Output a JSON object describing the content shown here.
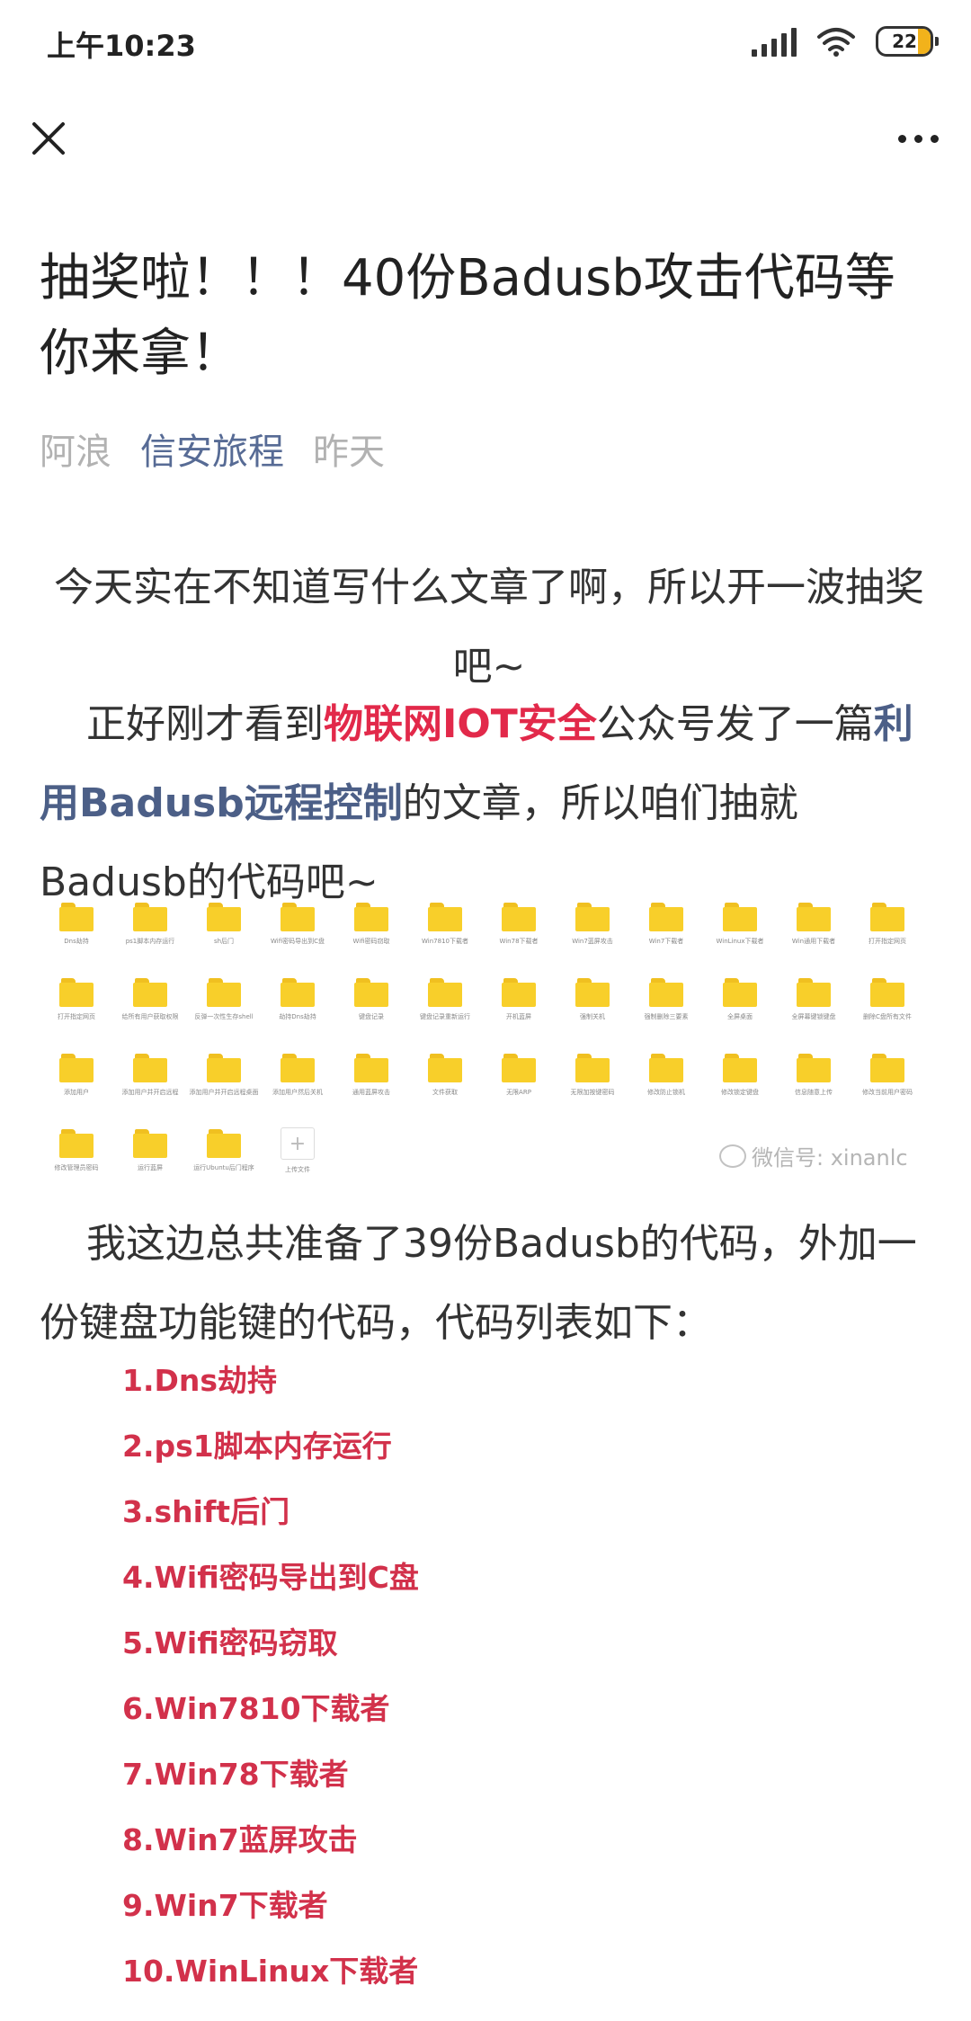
{
  "status": {
    "time": "上午10:23",
    "battery": "22",
    "battery_level": 0.22
  },
  "nav": {
    "close_icon": "close-icon",
    "more_icon": "more-icon"
  },
  "article": {
    "title": "抽奖啦！！！40份Badusb攻击代码等你来拿！",
    "author": "阿浪",
    "account": "信安旅程",
    "time": "昨天",
    "intro": "今天实在不知道写什么文章了啊，所以开一波抽奖吧~",
    "p2_a": "正好刚才看到",
    "p2_hl1": "物联网IOT安全",
    "p2_b": "公众号发了一篇",
    "p2_hl2": "利用Badusb远程控制",
    "p2_c": "的文章，所以咱们抽就Badusb的代码吧~",
    "p3": "我这边总共准备了39份Badusb的代码，外加一份键盘功能键的代码，代码列表如下：",
    "watermark": "微信号: xinanlc",
    "accent_red": "#e2294a",
    "accent_blue": "#4c5f87",
    "link_blue": "#576b95"
  },
  "folders": [
    "Dns劫持",
    "ps1脚本内存运行",
    "sh后门",
    "Wifi密码导出到C盘",
    "Wifi密码窃取",
    "Win7810下载者",
    "Win78下载者",
    "Win7蓝屏攻击",
    "Win7下载者",
    "WinLinux下载者",
    "Win通用下载者",
    "打开指定网页",
    "打开指定网页",
    "给所有用户获取权限",
    "反弹一次性生存shell",
    "劫持Dns劫持",
    "键盘记录",
    "键盘记录重新运行",
    "开机蓝屏",
    "强制关机",
    "强制删除三要素",
    "全屏桌面",
    "全屏幕键锁键盘",
    "删除C盘所有文件",
    "添加用户",
    "添加用户并开启远程",
    "添加用户并开启远程桌面",
    "添加用户然后关机",
    "通用蓝屏攻击",
    "文件获取",
    "无限ARP",
    "无限加按键密码",
    "修改防止锁机",
    "修改锁定键盘",
    "信息随意上传",
    "修改当前用户密码",
    "修改管理员密码",
    "运行蓝屏",
    "运行Ubuntu后门程序"
  ],
  "upload_label": "上传文件",
  "code_list": [
    "1.Dns劫持",
    "2.ps1脚本内存运行",
    "3.shift后门",
    "4.Wifi密码导出到C盘",
    "5.Wifi密码窃取",
    "6.Win7810下载者",
    "7.Win78下载者",
    "8.Win7蓝屏攻击",
    "9.Win7下载者",
    "10.WinLinux下载者"
  ]
}
